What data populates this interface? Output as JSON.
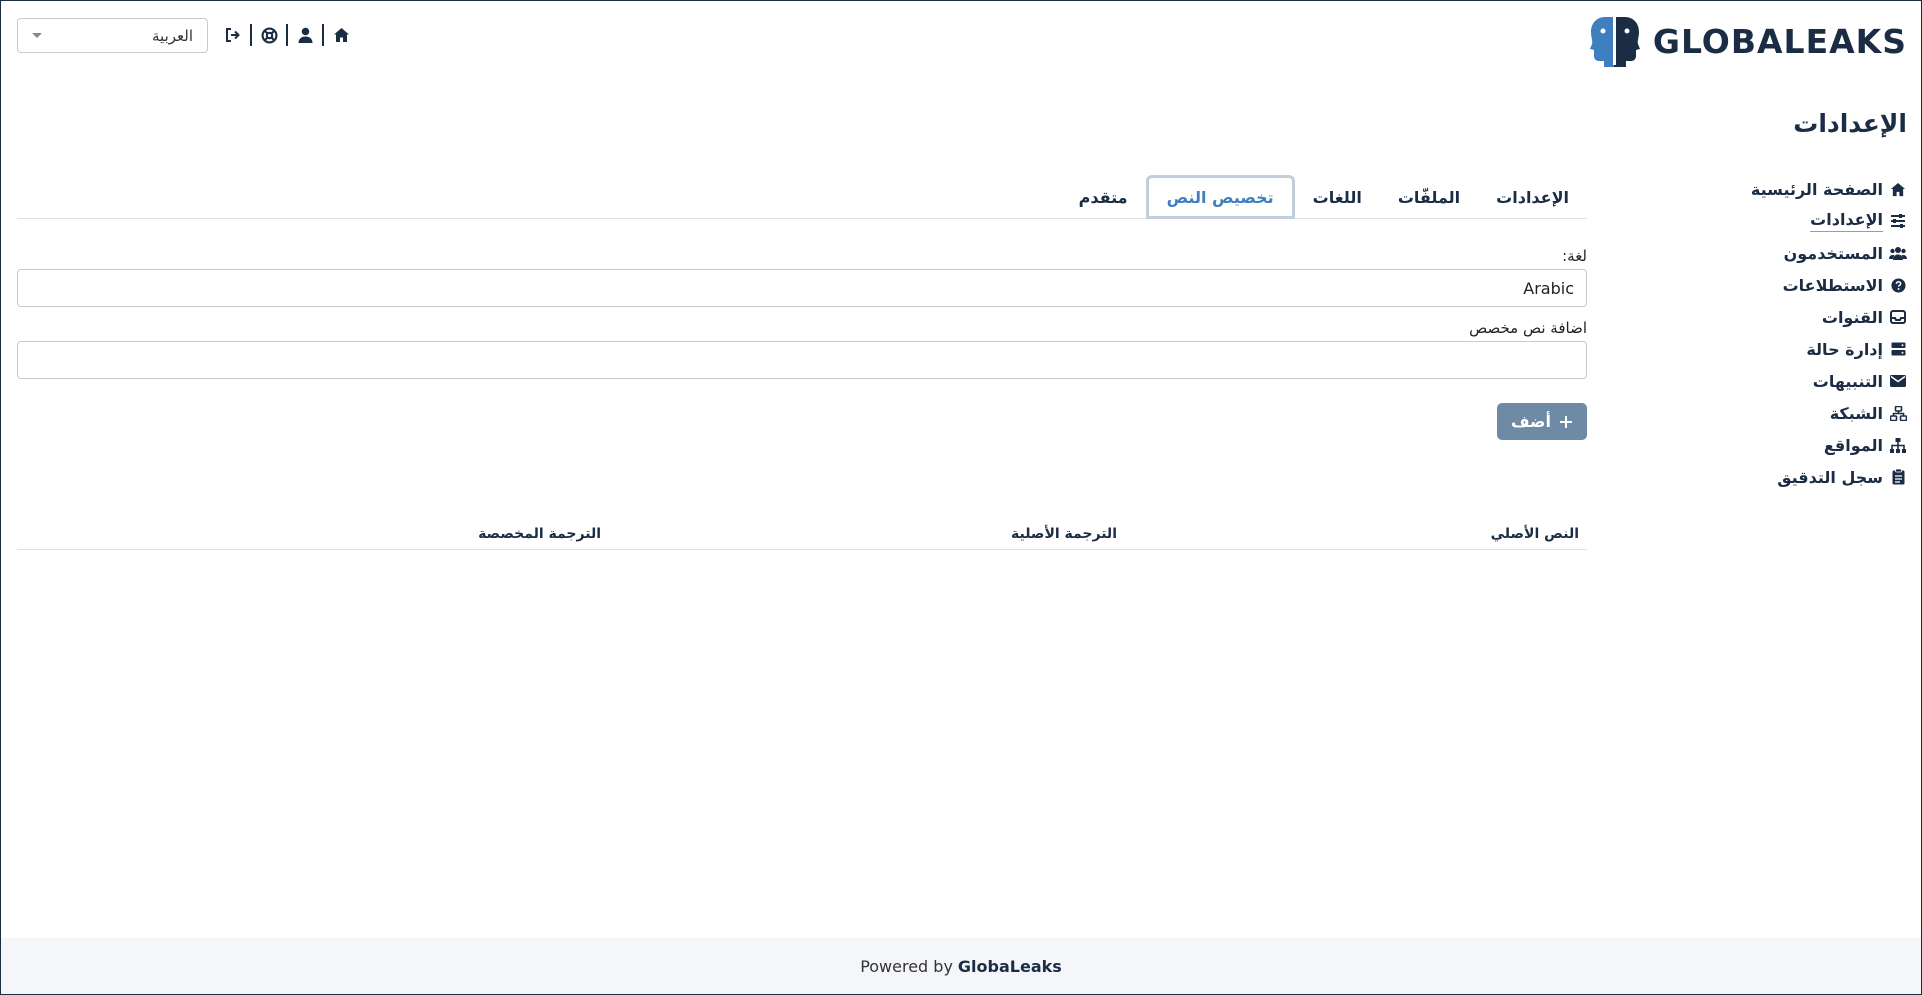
{
  "header": {
    "brand": "GLOBALEAKS",
    "language_select": {
      "value": "العربية"
    },
    "icons": [
      "logout-icon",
      "support-icon",
      "user-icon",
      "home-icon"
    ]
  },
  "page": {
    "title": "الإعدادات"
  },
  "sidebar": {
    "items": [
      {
        "label": "الصفحة الرئيسية",
        "icon": "home-icon"
      },
      {
        "label": "الإعدادات",
        "icon": "sliders-icon",
        "active": true
      },
      {
        "label": "المستخدمون",
        "icon": "users-icon"
      },
      {
        "label": "الاستطلاعات",
        "icon": "question-icon"
      },
      {
        "label": "القنوات",
        "icon": "inbox-icon"
      },
      {
        "label": "إدارة حالة",
        "icon": "server-icon"
      },
      {
        "label": "التنبيهات",
        "icon": "envelope-icon"
      },
      {
        "label": "الشبكة",
        "icon": "network-icon"
      },
      {
        "label": "المواقع",
        "icon": "sitemap-icon"
      },
      {
        "label": "سجل التدقيق",
        "icon": "clipboard-icon"
      }
    ]
  },
  "tabs": [
    {
      "label": "الإعدادات"
    },
    {
      "label": "الملفّات"
    },
    {
      "label": "اللغات"
    },
    {
      "label": "تخصيص النص",
      "active": true
    },
    {
      "label": "متقدم"
    }
  ],
  "form": {
    "language_label": "لغة:",
    "language_value": "Arabic",
    "custom_text_label": "اضافة نص مخصص",
    "custom_text_value": "",
    "add_button": "أضف"
  },
  "table": {
    "headers": [
      "النص الأصلي",
      "الترجمة الأصلية",
      "الترجمة المخصصة"
    ]
  },
  "footer": {
    "prefix": "Powered by",
    "brand": "GlobaLeaks"
  },
  "colors": {
    "primary": "#1b2d44",
    "accent": "#3f7fbf",
    "button": "#6e8aa5"
  }
}
